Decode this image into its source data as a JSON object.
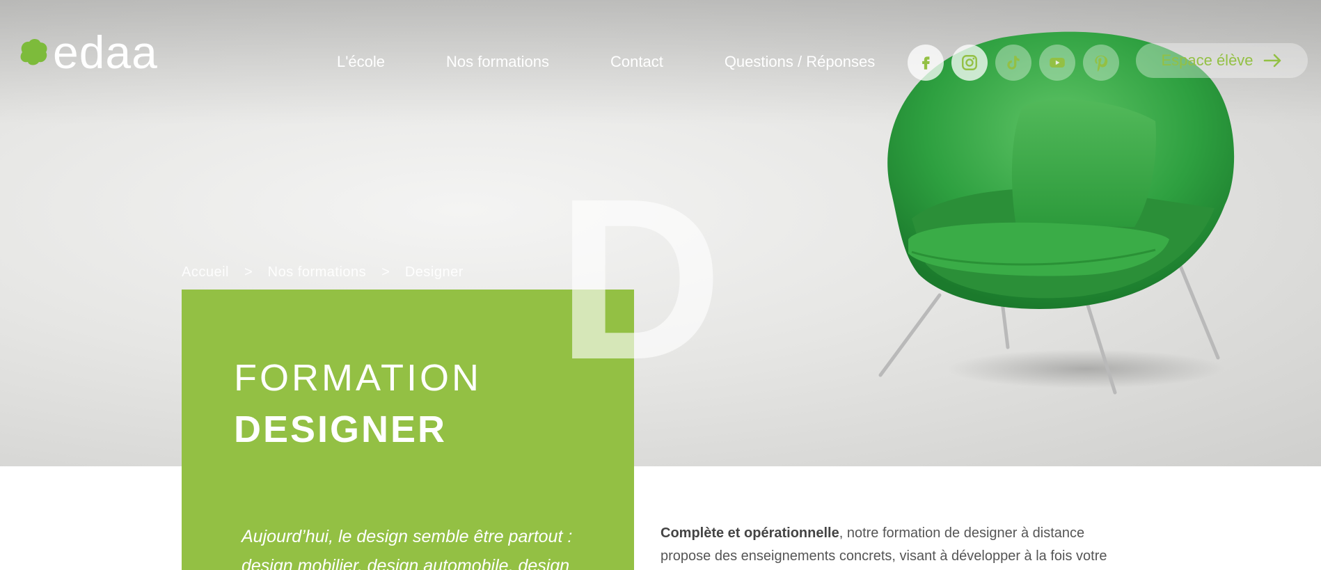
{
  "brand": {
    "name": "edaa",
    "accent_color": "#93c044",
    "logo_icon": "green-blob-icon"
  },
  "nav": {
    "items": [
      {
        "label": "L'école"
      },
      {
        "label": "Nos formations"
      },
      {
        "label": "Contact"
      },
      {
        "label": "Questions / Réponses"
      }
    ]
  },
  "social": {
    "icons": [
      "facebook-icon",
      "instagram-icon",
      "tiktok-icon",
      "youtube-icon",
      "pinterest-icon"
    ]
  },
  "account": {
    "label": "Espace élève",
    "icon": "arrow-right-icon"
  },
  "breadcrumb": {
    "items": [
      "Accueil",
      "Nos formations",
      "Designer"
    ],
    "separator": ">"
  },
  "hero": {
    "big_letter": "D",
    "title_line1": "FORMATION",
    "title_line2": "DESIGNER",
    "intro": "Aujourd’hui, le design semble être partout : design mobilier, design automobile, design"
  },
  "content": {
    "lead_bold": "Complète et opérationnelle",
    "lead_rest": ", notre formation de designer à distance propose des enseignements concrets, visant à développer à la fois votre"
  }
}
